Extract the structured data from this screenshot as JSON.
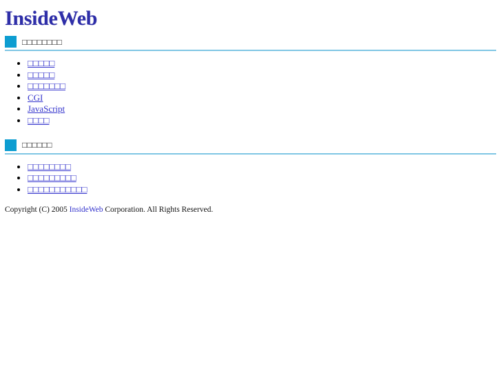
{
  "site": {
    "logo_text": "InsideWeb",
    "accent_square_color": "#0D9DD1",
    "accent_rule_color": "#7FC6E4",
    "logo_color": "#2E2EA8",
    "link_color": "#3333CC"
  },
  "sections": [
    {
      "heading": "□□□□□□□□",
      "items": [
        {
          "label": "□□□□□"
        },
        {
          "label": "□□□□□"
        },
        {
          "label": "□□□□□□□"
        },
        {
          "label": "CGI"
        },
        {
          "label": "JavaScript"
        },
        {
          "label": "□□□□"
        }
      ]
    },
    {
      "heading": "□□□□□□",
      "items": [
        {
          "label": "□□□□□□□□"
        },
        {
          "label": "□□□□□□□□□"
        },
        {
          "label": "□□□□□□□□□□□"
        }
      ]
    }
  ],
  "footer": {
    "prefix": "Copyright (C) 2005 ",
    "brand": "InsideWeb",
    "suffix": " Corporation. All Rights Reserved."
  }
}
